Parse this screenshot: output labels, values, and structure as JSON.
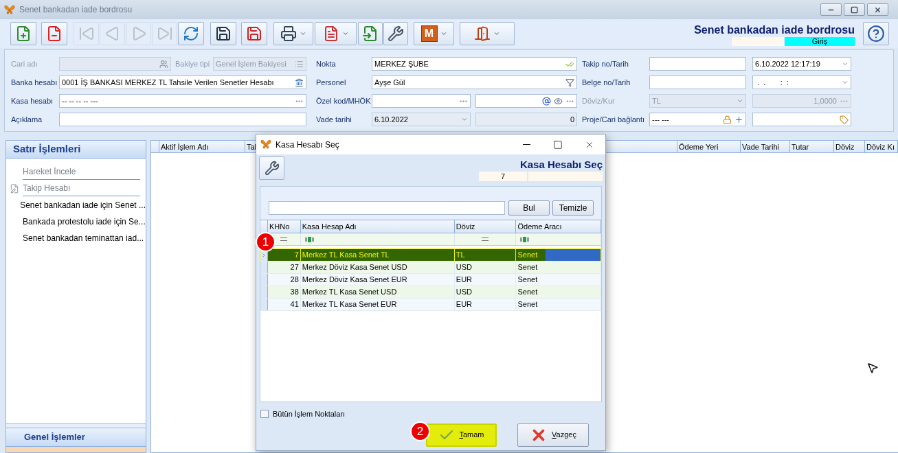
{
  "window": {
    "title": "Senet bankadan iade bordrosu"
  },
  "toolbar": {
    "buttons": [
      {
        "kind": "new",
        "disabled": false
      },
      {
        "kind": "delete",
        "disabled": false
      },
      {
        "kind": "first",
        "disabled": true
      },
      {
        "kind": "prev",
        "disabled": true
      },
      {
        "kind": "next",
        "disabled": true
      },
      {
        "kind": "last",
        "disabled": true
      },
      {
        "kind": "refresh",
        "disabled": false
      },
      {
        "kind": "save",
        "disabled": false
      },
      {
        "kind": "discard",
        "disabled": false
      },
      {
        "kind": "print",
        "disabled": false
      },
      {
        "kind": "pdf",
        "disabled": false
      },
      {
        "kind": "import",
        "disabled": false
      },
      {
        "kind": "tools",
        "disabled": false
      },
      {
        "kind": "m-menu",
        "label": "M",
        "disabled": false
      },
      {
        "kind": "exit",
        "disabled": false
      }
    ]
  },
  "header": {
    "title": "Senet bankadan iade bordrosu",
    "status": "Giriş"
  },
  "form": {
    "sections": [
      {
        "rows": [
          {
            "label": "Cari adı",
            "disabled": true,
            "fields": [
              {
                "kind": "field",
                "disabled": true
              },
              {
                "kind": "label",
                "text": "Bakiye tipi",
                "disabled": true
              },
              {
                "kind": "field",
                "value": "Genel İşlem Bakiyesi",
                "disabled": true
              }
            ]
          },
          {
            "label": "Banka hesabı",
            "disabled": false,
            "fields": [
              {
                "kind": "field",
                "value": "0001 İŞ BANKASI MERKEZ TL Tahsile Verilen Senetler Hesabı",
                "disabled": false
              }
            ]
          },
          {
            "label": "Kasa hesabı",
            "disabled": false,
            "fields": [
              {
                "kind": "field",
                "value": "-- -- -- -- ---",
                "disabled": false
              }
            ]
          },
          {
            "label": "Açıklama",
            "disabled": false,
            "fields": [
              {
                "kind": "field",
                "disabled": false
              }
            ]
          }
        ]
      },
      {
        "rows": [
          {
            "label": "Nokta",
            "disabled": false,
            "fields": [
              {
                "kind": "field",
                "value": "MERKEZ ŞUBE",
                "disabled": false
              }
            ]
          },
          {
            "label": "Personel",
            "disabled": false,
            "fields": [
              {
                "kind": "field",
                "value": "Ayşe Gül",
                "disabled": false
              }
            ]
          },
          {
            "label": "Özel kod/MHÖK",
            "disabled": false,
            "fields": [
              {
                "kind": "field",
                "disabled": false
              },
              {
                "kind": "field",
                "disabled": false
              }
            ]
          },
          {
            "label": "Vade tarihi",
            "disabled": false,
            "fields": [
              {
                "kind": "dropdown",
                "value": "6.10.2022",
                "disabled": false,
                "readonly": true
              },
              {
                "kind": "number",
                "value": "0",
                "disabled": false,
                "readonly": true
              }
            ]
          }
        ]
      },
      {
        "rows": [
          {
            "label": "Takip no/Tarih",
            "disabled": false,
            "fields": [
              {
                "kind": "field",
                "disabled": false
              },
              {
                "kind": "dropdown",
                "value": "6.10.2022 12:17:19",
                "disabled": false
              }
            ]
          },
          {
            "label": "Belge no/Tarih",
            "disabled": false,
            "fields": [
              {
                "kind": "field",
                "disabled": false
              },
              {
                "kind": "dropdown",
                "value": " .  .       :  :",
                "disabled": false
              }
            ]
          },
          {
            "label": "Döviz/Kur",
            "disabled": true,
            "fields": [
              {
                "kind": "dropdown",
                "value": "TL",
                "disabled": true
              },
              {
                "kind": "number",
                "value": "1,0000",
                "disabled": true
              }
            ]
          },
          {
            "label": "Proje/Cari bağlantı",
            "disabled": false,
            "fields": [
              {
                "kind": "field",
                "value": "--- ---",
                "disabled": false
              },
              {
                "kind": "field",
                "disabled": false
              }
            ]
          }
        ]
      }
    ]
  },
  "side_panel": {
    "title": "Satır İşlemleri",
    "items": [
      {
        "label": "Hareket İncele",
        "disabled": true,
        "kind": "plain"
      },
      {
        "label": "Takip Hesabı",
        "disabled": true,
        "kind": "with-icon"
      },
      {
        "label": "Senet bankadan iade için Senet ...",
        "disabled": false,
        "kind": "plain"
      },
      {
        "label": "Bankada protestolu iade için Se...",
        "disabled": false,
        "kind": "plain"
      },
      {
        "label": "Senet bankadan teminattan iad...",
        "disabled": false,
        "kind": "plain"
      }
    ],
    "footer": "Genel İşlemler"
  },
  "grid": {
    "columns": [
      "Aktif İşlem Adı",
      "Tal",
      "Ödeme Yeri",
      "Vade Tarihi",
      "Tutar",
      "Döviz",
      "Döviz Kı"
    ]
  },
  "dialog": {
    "title": "Kasa Hesabı Seç",
    "heading": "Kasa Hesabı Seç",
    "code": "7",
    "find_button": "Bul",
    "clear_button": "Temizle",
    "columns": [
      "KHNo",
      "Kasa Hesap Adı",
      "Döviz",
      "Ödeme Aracı"
    ],
    "rows": [
      {
        "cells": [
          "7",
          "Merkez TL Kasa Senet TL",
          "TL",
          "Senet"
        ],
        "selected": true
      },
      {
        "cells": [
          "27",
          "Merkez Döviz Kasa Senet USD",
          "USD",
          "Senet"
        ],
        "selected": false
      },
      {
        "cells": [
          "28",
          "Merkez Döviz Kasa Senet EUR",
          "EUR",
          "Senet"
        ],
        "selected": false
      },
      {
        "cells": [
          "38",
          "Merkez TL Kasa Senet USD",
          "USD",
          "Senet"
        ],
        "selected": false
      },
      {
        "cells": [
          "41",
          "Merkez TL Kasa Senet EUR",
          "EUR",
          "Senet"
        ],
        "selected": false
      }
    ],
    "checkbox": {
      "label": "Bütün İşlem Noktaları",
      "checked": false
    },
    "ok_button": {
      "label": "Tamam",
      "highlighted": true
    },
    "cancel_button": {
      "label": "Vazgeç",
      "highlighted": false
    }
  },
  "annotations": [
    "1",
    "2"
  ]
}
